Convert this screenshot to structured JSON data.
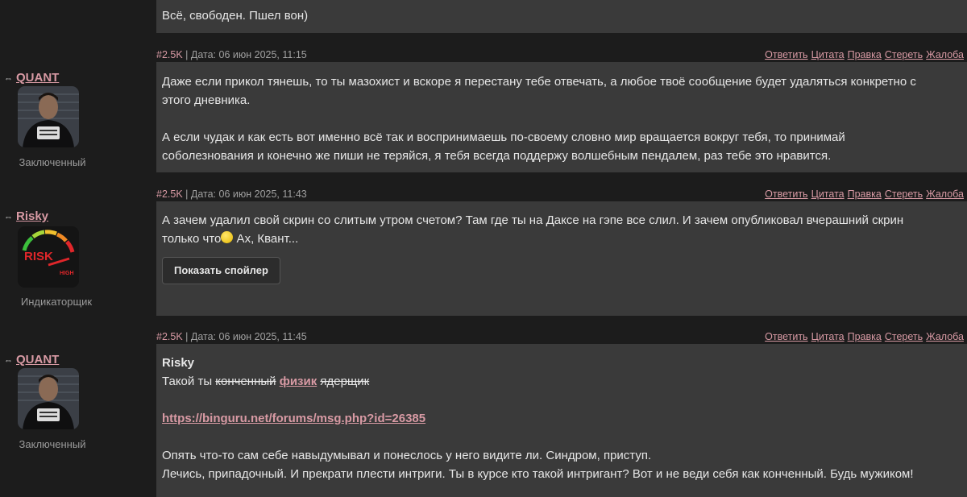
{
  "top_message": "Всё, свободен. Пшел вон)",
  "actions": [
    "Ответить",
    "Цитата",
    "Правка",
    "Стереть",
    "Жалоба"
  ],
  "posts": [
    {
      "user": "QUANT",
      "status": "Заключенный",
      "num": "#2.5K",
      "date": "| Дата: 06 июн 2025, 11:15",
      "paragraphs": [
        "Даже если прикол тянешь, то ты мазохист и вскоре я перестану тебе отвечать, а любое твоё сообщение будет удаляться конкретно с",
        "этого дневника.",
        "",
        "А если чудак и как есть вот именно всё так и воспринимаешь по-своему словно мир вращается вокруг тебя, то принимай",
        "соболезнования и конечно же пиши не теряйся, я тебя всегда поддержу волшебным пендалем, раз тебе это нравится."
      ]
    },
    {
      "user": "Risky",
      "status": "Индикаторщик",
      "num": "#2.5K",
      "date": "| Дата: 06 июн 2025, 11:43",
      "line1": "А зачем удалил свой скрин со слитым утром счетом? Там где ты на Даксе на гэпе все слил. И зачем опубликовал вчерашний скрин",
      "line2a": "только что",
      "line2b": " Ах, Квант...",
      "spoiler_button": "Показать спойлер"
    },
    {
      "user": "QUANT",
      "status": "Заключенный",
      "num": "#2.5K",
      "date": "| Дата: 06 июн 2025, 11:45",
      "quote_author": "Risky",
      "q_prefix": "Такой ты ",
      "q_strike1": "конченный",
      "q_link": "физик",
      "q_strike2": "ядерщик",
      "url": "https://binguru.net/forums/msg.php?id=26385",
      "line1": "Опять что-то сам себе навыдумывал и понеслось у него видите ли. Синдром, приступ.",
      "line2": "Лечись, припадочный. И прекрати плести интриги. Ты в курсе кто такой интригант? Вот и не веди себя как конченный. Будь мужиком!"
    }
  ]
}
